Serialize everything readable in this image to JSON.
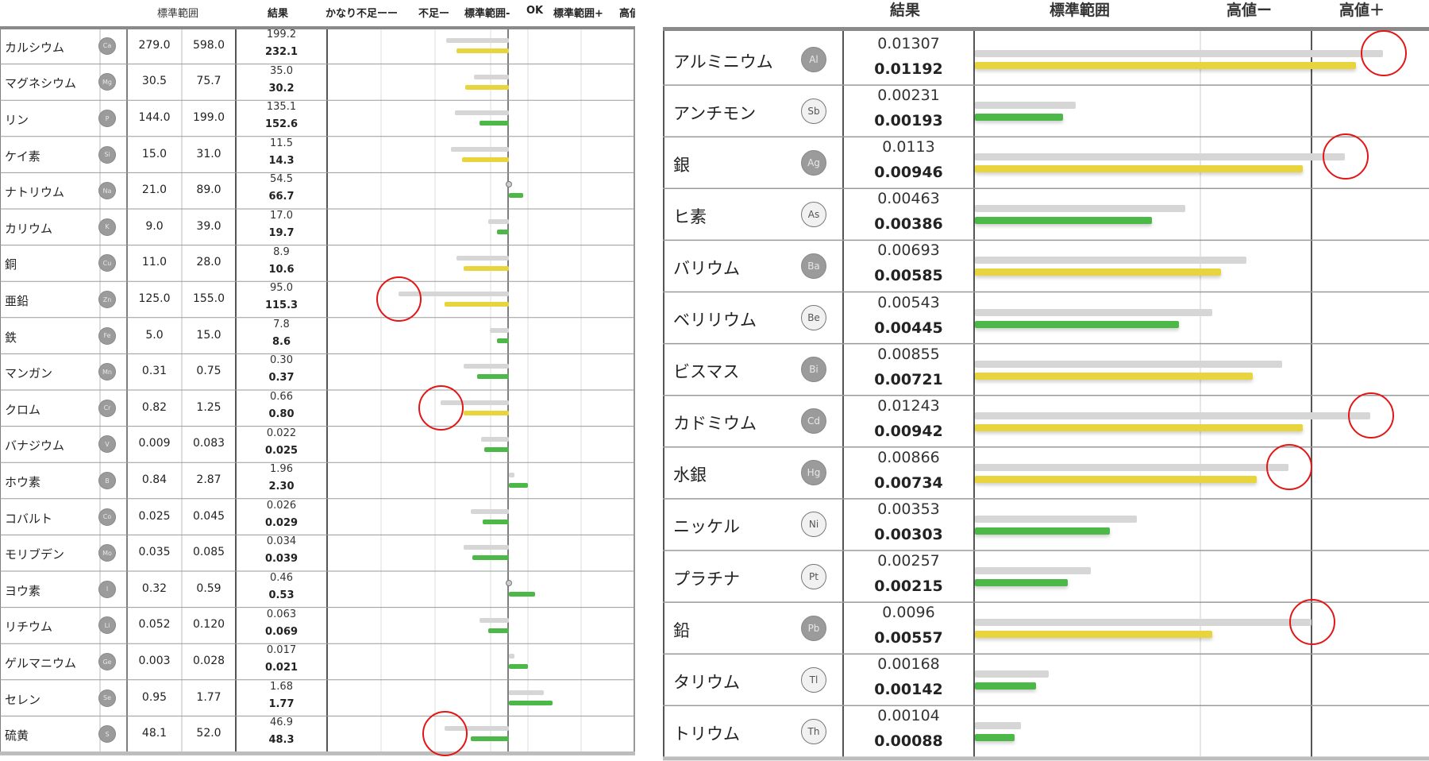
{
  "colors": {
    "ok": "#4cb847",
    "warn": "#e8d43c",
    "previous": "#d6d6d6",
    "alert": "#e31515"
  },
  "left_panel": {
    "headers": {
      "range": "標準範囲",
      "result": "結果",
      "very_low": "かなり不足ーー",
      "low": "不足ー",
      "range_minus": "標準範囲-",
      "ok": "OK",
      "range_plus": "標準範囲+",
      "high_cut": "高値"
    }
  },
  "right_panel": {
    "headers": {
      "result": "結果",
      "range": "標準範囲",
      "high_minus": "高値ー",
      "high_plus": "高値＋"
    }
  },
  "chart_data": [
    {
      "type": "bar",
      "series": [
        {
          "name": "",
          "role": "previous"
        },
        {
          "name": "",
          "role": "current"
        }
      ],
      "rows": [
        {
          "name": "カルシウム",
          "symbol": "Ca",
          "range_low": "279.0",
          "range_high": "598.0",
          "previous": "199.2",
          "current": "232.1",
          "status": "warn",
          "prev_level": -0.36,
          "cur_level": -0.3,
          "circled": false
        },
        {
          "name": "マグネシウム",
          "symbol": "Mg",
          "range_low": "30.5",
          "range_high": "75.7",
          "previous": "35.0",
          "current": "30.2",
          "status": "warn",
          "prev_level": -0.2,
          "cur_level": -0.25,
          "circled": false
        },
        {
          "name": "リン",
          "symbol": "P",
          "range_low": "144.0",
          "range_high": "199.0",
          "previous": "135.1",
          "current": "152.6",
          "status": "ok",
          "prev_level": -0.31,
          "cur_level": -0.17,
          "circled": false
        },
        {
          "name": "ケイ素",
          "symbol": "Si",
          "range_low": "15.0",
          "range_high": "31.0",
          "previous": "11.5",
          "current": "14.3",
          "status": "warn",
          "prev_level": -0.33,
          "cur_level": -0.27,
          "circled": false
        },
        {
          "name": "ナトリウム",
          "symbol": "Na",
          "range_low": "21.0",
          "range_high": "89.0",
          "previous": "54.5",
          "current": "66.7",
          "status": "ok",
          "prev_level": 0,
          "cur_level": 0.08,
          "circled": false
        },
        {
          "name": "カリウム",
          "symbol": "K",
          "range_low": "9.0",
          "range_high": "39.0",
          "previous": "17.0",
          "current": "19.7",
          "status": "ok",
          "prev_level": -0.12,
          "cur_level": -0.07,
          "circled": false
        },
        {
          "name": "銅",
          "symbol": "Cu",
          "range_low": "11.0",
          "range_high": "28.0",
          "previous": "8.9",
          "current": "10.6",
          "status": "warn",
          "prev_level": -0.3,
          "cur_level": -0.26,
          "circled": false
        },
        {
          "name": "亜鉛",
          "symbol": "Zn",
          "range_low": "125.0",
          "range_high": "155.0",
          "previous": "95.0",
          "current": "115.3",
          "status": "warn",
          "prev_level": -0.63,
          "cur_level": -0.37,
          "circled": true
        },
        {
          "name": "鉄",
          "symbol": "Fe",
          "range_low": "5.0",
          "range_high": "15.0",
          "previous": "7.8",
          "current": "8.6",
          "status": "ok",
          "prev_level": -0.11,
          "cur_level": -0.07,
          "circled": false
        },
        {
          "name": "マンガン",
          "symbol": "Mn",
          "range_low": "0.31",
          "range_high": "0.75",
          "previous": "0.30",
          "current": "0.37",
          "status": "ok",
          "prev_level": -0.26,
          "cur_level": -0.18,
          "circled": false
        },
        {
          "name": "クロム",
          "symbol": "Cr",
          "range_low": "0.82",
          "range_high": "1.25",
          "previous": "0.66",
          "current": "0.80",
          "status": "warn",
          "prev_level": -0.39,
          "cur_level": -0.26,
          "circled": true
        },
        {
          "name": "バナジウム",
          "symbol": "V",
          "range_low": "0.009",
          "range_high": "0.083",
          "previous": "0.022",
          "current": "0.025",
          "status": "ok",
          "prev_level": -0.16,
          "cur_level": -0.14,
          "circled": false
        },
        {
          "name": "ホウ素",
          "symbol": "B",
          "range_low": "0.84",
          "range_high": "2.87",
          "previous": "1.96",
          "current": "2.30",
          "status": "ok",
          "prev_level": 0.03,
          "cur_level": 0.11,
          "circled": false
        },
        {
          "name": "コバルト",
          "symbol": "Co",
          "range_low": "0.025",
          "range_high": "0.045",
          "previous": "0.026",
          "current": "0.029",
          "status": "ok",
          "prev_level": -0.22,
          "cur_level": -0.15,
          "circled": false
        },
        {
          "name": "モリブデン",
          "symbol": "Mo",
          "range_low": "0.035",
          "range_high": "0.085",
          "previous": "0.034",
          "current": "0.039",
          "status": "ok",
          "prev_level": -0.26,
          "cur_level": -0.21,
          "circled": false
        },
        {
          "name": "ヨウ素",
          "symbol": "I",
          "range_low": "0.32",
          "range_high": "0.59",
          "previous": "0.46",
          "current": "0.53",
          "status": "ok",
          "prev_level": 0,
          "cur_level": 0.15,
          "circled": false
        },
        {
          "name": "リチウム",
          "symbol": "Li",
          "range_low": "0.052",
          "range_high": "0.120",
          "previous": "0.063",
          "current": "0.069",
          "status": "ok",
          "prev_level": -0.17,
          "cur_level": -0.12,
          "circled": false
        },
        {
          "name": "ゲルマニウム",
          "symbol": "Ge",
          "range_low": "0.003",
          "range_high": "0.028",
          "previous": "0.017",
          "current": "0.021",
          "status": "ok",
          "prev_level": 0.03,
          "cur_level": 0.11,
          "circled": false
        },
        {
          "name": "セレン",
          "symbol": "Se",
          "range_low": "0.95",
          "range_high": "1.77",
          "previous": "1.68",
          "current": "1.77",
          "status": "ok",
          "prev_level": 0.2,
          "cur_level": 0.25,
          "circled": false
        },
        {
          "name": "硫黄",
          "symbol": "S",
          "range_low": "48.1",
          "range_high": "52.0",
          "previous": "46.9",
          "current": "48.3",
          "status": "ok",
          "prev_level": -0.37,
          "cur_level": -0.22,
          "circled": true
        }
      ]
    },
    {
      "type": "bar",
      "series": [
        {
          "name": "",
          "role": "previous"
        },
        {
          "name": "",
          "role": "current"
        }
      ],
      "rows": [
        {
          "name": "アルミニウム",
          "symbol": "Al",
          "previous": "0.01307",
          "current": "0.01192",
          "status": "warn",
          "prev_level": 0.97,
          "cur_level": 0.905,
          "circled": true
        },
        {
          "name": "アンチモン",
          "symbol": "Sb",
          "previous": "0.00231",
          "current": "0.00193",
          "status": "ok",
          "prev_level": 0.24,
          "cur_level": 0.21,
          "circled": false
        },
        {
          "name": "銀",
          "symbol": "Ag",
          "previous": "0.0113",
          "current": "0.00946",
          "status": "warn",
          "prev_level": 0.88,
          "cur_level": 0.78,
          "circled": true
        },
        {
          "name": "ヒ素",
          "symbol": "As",
          "previous": "0.00463",
          "current": "0.00386",
          "status": "ok",
          "prev_level": 0.5,
          "cur_level": 0.42,
          "circled": false
        },
        {
          "name": "バリウム",
          "symbol": "Ba",
          "previous": "0.00693",
          "current": "0.00585",
          "status": "warn",
          "prev_level": 0.645,
          "cur_level": 0.585,
          "circled": false
        },
        {
          "name": "ベリリウム",
          "symbol": "Be",
          "previous": "0.00543",
          "current": "0.00445",
          "status": "ok",
          "prev_level": 0.565,
          "cur_level": 0.485,
          "circled": false
        },
        {
          "name": "ビスマス",
          "symbol": "Bi",
          "previous": "0.00855",
          "current": "0.00721",
          "status": "warn",
          "prev_level": 0.73,
          "cur_level": 0.66,
          "circled": false
        },
        {
          "name": "カドミウム",
          "symbol": "Cd",
          "previous": "0.01243",
          "current": "0.00942",
          "status": "warn",
          "prev_level": 0.94,
          "cur_level": 0.78,
          "circled": true
        },
        {
          "name": "水銀",
          "symbol": "Hg",
          "previous": "0.00866",
          "current": "0.00734",
          "status": "warn",
          "prev_level": 0.745,
          "cur_level": 0.67,
          "circled": true
        },
        {
          "name": "ニッケル",
          "symbol": "Ni",
          "previous": "0.00353",
          "current": "0.00303",
          "status": "ok",
          "prev_level": 0.385,
          "cur_level": 0.32,
          "circled": false
        },
        {
          "name": "プラチナ",
          "symbol": "Pt",
          "previous": "0.00257",
          "current": "0.00215",
          "status": "ok",
          "prev_level": 0.275,
          "cur_level": 0.22,
          "circled": false
        },
        {
          "name": "鉛",
          "symbol": "Pb",
          "previous": "0.0096",
          "current": "0.00557",
          "status": "warn",
          "prev_level": 0.8,
          "cur_level": 0.565,
          "circled": true
        },
        {
          "name": "タリウム",
          "symbol": "Tl",
          "previous": "0.00168",
          "current": "0.00142",
          "status": "ok",
          "prev_level": 0.175,
          "cur_level": 0.145,
          "circled": false
        },
        {
          "name": "トリウム",
          "symbol": "Th",
          "previous": "0.00104",
          "current": "0.00088",
          "status": "ok",
          "prev_level": 0.11,
          "cur_level": 0.095,
          "circled": false
        }
      ]
    }
  ]
}
